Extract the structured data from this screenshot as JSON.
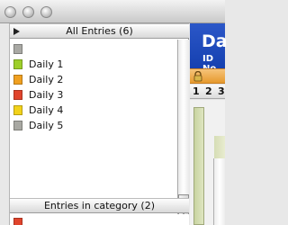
{
  "left_panel": {
    "all_entries_header": "All Entries (6)",
    "entries_in_category_header": "Entries in category (2)",
    "items": [
      {
        "label": "",
        "color": "#a9a9a4"
      },
      {
        "label": "Daily 1",
        "color": "#9ecf2a"
      },
      {
        "label": "Daily 2",
        "color": "#f0a020"
      },
      {
        "label": "Daily 3",
        "color": "#e0442c"
      },
      {
        "label": "Daily 4",
        "color": "#f2d21a"
      },
      {
        "label": "Daily 5",
        "color": "#a8a8a2"
      }
    ]
  },
  "right_pane": {
    "title": "Da",
    "id_label": "ID No",
    "day_numbers": [
      "1",
      "2",
      "3"
    ]
  },
  "colors": {
    "header_blue": "#1e4bbd",
    "lock_bar_orange": "#eba640"
  }
}
